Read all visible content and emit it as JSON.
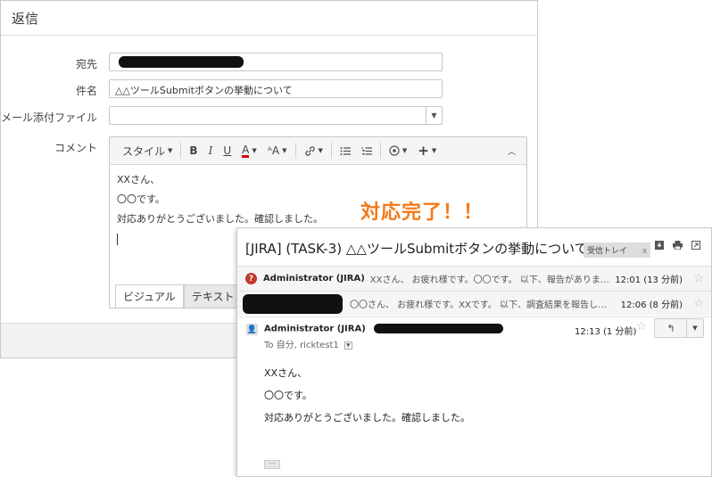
{
  "reply_dialog": {
    "title": "返信",
    "to_label": "宛先",
    "subject_label": "件名",
    "subject_value": "△△ツールSubmitボタンの挙動について",
    "attachment_label": "メール添付ファイル",
    "comment_label": "コメント",
    "toolbar": {
      "style_label": "スタイル",
      "bold": "B",
      "italic": "I",
      "underline": "U",
      "text_color": "A",
      "font_size": "ᴬA"
    },
    "body_lines": [
      "XXさん、",
      "〇〇です。",
      "対応ありがとうございました。確認しました。"
    ],
    "tab_visual": "ビジュアル",
    "tab_text": "テキスト"
  },
  "annotation": {
    "text": "対応完了！！",
    "color": "#f07a1a"
  },
  "email_view": {
    "subject": "[JIRA] (TASK-3) △△ツールSubmitボタンの挙動について",
    "inbox_chip": "受信トレイ",
    "inbox_chip_close": "x",
    "messages": [
      {
        "sender": "Administrator (JIRA)",
        "snippet": "XXさん、 お疲れ様です。〇〇です。 以下、報告がありま…",
        "time": "12:01 (13 分前)"
      },
      {
        "sender": "",
        "snippet": "〇〇さん、 お疲れ様です。XXです。 以下、調査結果を報告し…",
        "time": "12:06 (8 分前)"
      }
    ],
    "open_message": {
      "sender": "Administrator (JIRA)",
      "to": "To 自分, ricktest1",
      "time": "12:13 (1 分前)",
      "body_lines": [
        "XXさん、",
        "〇〇です。",
        "対応ありがとうございました。確認しました。"
      ]
    },
    "ellipsis": "···"
  },
  "icons": [
    "chevron-down-icon",
    "link-icon",
    "bullet-list-icon",
    "numbered-list-icon",
    "media-icon",
    "plus-icon",
    "collapse-icon",
    "download-icon",
    "print-icon",
    "new-window-icon",
    "star-icon",
    "reply-icon",
    "unknown-sender-icon",
    "avatar-icon",
    "label-icon"
  ]
}
